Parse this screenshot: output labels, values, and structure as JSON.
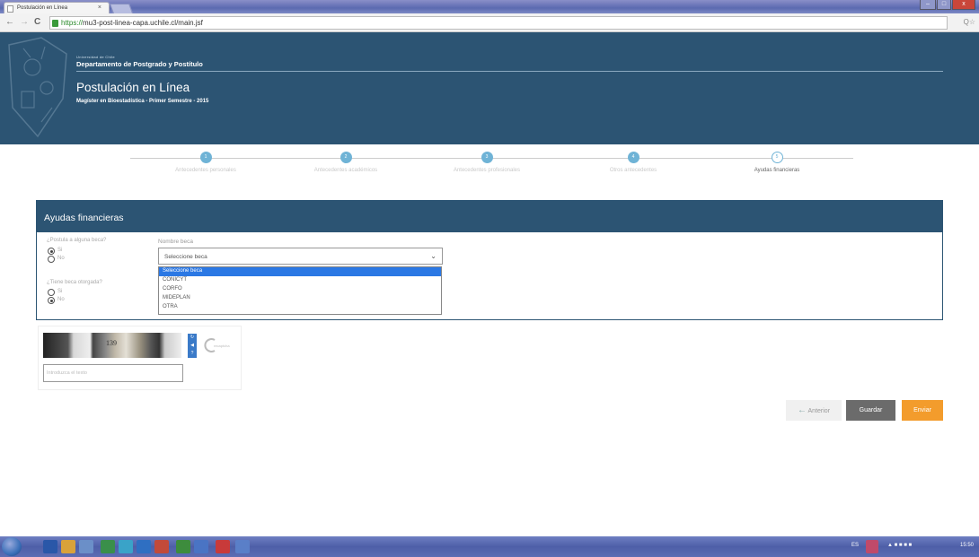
{
  "browser": {
    "tab_title": "Postulación en Línea",
    "tab_close": "×",
    "url_scheme": "https://",
    "url_rest": "mu3-post-linea-capa.uchile.cl/main.jsf",
    "back": "←",
    "forward": "→",
    "reload": "C",
    "search_icon": "Q☆",
    "min": "–",
    "max": "□",
    "close": "x"
  },
  "header": {
    "university": "Universidad de Chile",
    "department": "Departamento de Postgrado y Postítulo",
    "title": "Postulación en Línea",
    "subtitle": "Magíster en Bioestadística - Primer Semestre - 2015"
  },
  "steps": [
    {
      "number": "1",
      "label": "Antecedentes personales",
      "state": "done"
    },
    {
      "number": "2",
      "label": "Antecedentes académicos",
      "state": "done"
    },
    {
      "number": "3",
      "label": "Antecedentes profesionales",
      "state": "done"
    },
    {
      "number": "4",
      "label": "Otros antecedentes",
      "state": "done"
    },
    {
      "number": "5",
      "label": "Ayudas financieras",
      "state": "current"
    }
  ],
  "panel": {
    "title": "Ayudas financieras",
    "q1": {
      "label": "¿Postula a alguna beca?",
      "yes": "Si",
      "no": "No",
      "selected": "yes"
    },
    "q2": {
      "label": "¿Tiene beca otorgada?",
      "yes": "Si",
      "no": "No",
      "selected": "no"
    },
    "beca": {
      "label": "Nombre beca",
      "value": "Seleccione beca",
      "options": [
        "Seleccione beca",
        "CONICYT",
        "CORFO",
        "MIDEPLAN",
        "OTRA"
      ],
      "highlighted": 0
    }
  },
  "captcha": {
    "image_text": "139",
    "placeholder": "Introduzca el texto",
    "logo_text": "recaptcha"
  },
  "buttons": {
    "prev": "Anterior",
    "prev_icon": "←",
    "save": "Guardar",
    "send": "Enviar"
  },
  "taskbar": {
    "lang": "ES",
    "time": "15:50"
  },
  "colors": {
    "header": "#2c5473",
    "step": "#6fb3d6",
    "send": "#f39c2c",
    "save": "#6b6b6b",
    "highlight": "#2b78e4"
  }
}
